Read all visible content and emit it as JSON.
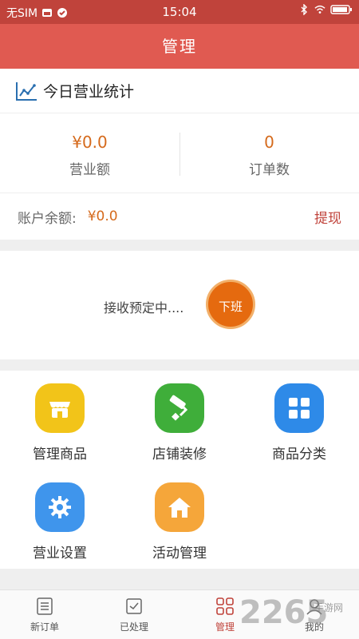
{
  "statusbar": {
    "carrier": "无SIM",
    "time": "15:04"
  },
  "header": {
    "title": "管理"
  },
  "stats": {
    "heading": "今日营业统计",
    "revenue_value": "¥0.0",
    "revenue_label": "营业额",
    "orders_value": "0",
    "orders_label": "订单数",
    "balance_label": "账户余额:",
    "balance_value": "¥0.0",
    "withdraw_label": "提现"
  },
  "shop_status": {
    "text": "接收预定中....",
    "button_label": "下班"
  },
  "grid": {
    "items": [
      {
        "label": "管理商品"
      },
      {
        "label": "店铺装修"
      },
      {
        "label": "商品分类"
      },
      {
        "label": "营业设置"
      },
      {
        "label": "活动管理"
      }
    ]
  },
  "tabbar": {
    "items": [
      {
        "label": "新订单"
      },
      {
        "label": "已处理"
      },
      {
        "label": "管理"
      },
      {
        "label": "我的"
      }
    ]
  },
  "watermark": {
    "text": "2265",
    "sub": "手游网"
  },
  "colors": {
    "header": "#e05a51",
    "statusbar": "#c0433b",
    "accent": "#d56a1c",
    "button": "#e56a0f"
  }
}
